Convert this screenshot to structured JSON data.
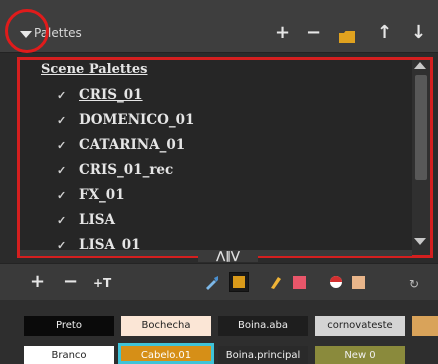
{
  "header": {
    "title": "Palettes",
    "add_glyph": "+",
    "remove_glyph": "−",
    "up_glyph": "↑",
    "down_glyph": "↓"
  },
  "palette_list": {
    "section_label": "Scene Palettes",
    "check_glyph": "✓",
    "items": [
      {
        "label": "CRIS_01"
      },
      {
        "label": "DOMENICO_01"
      },
      {
        "label": "CATARINA_01"
      },
      {
        "label": "CRIS_01_rec"
      },
      {
        "label": "FX_01"
      },
      {
        "label": "LISA"
      },
      {
        "label": "LISA_01"
      }
    ],
    "collapse_glyphs": "⋀‖⋁"
  },
  "colors_toolbar": {
    "add_glyph": "+",
    "remove_glyph": "−",
    "texture_glyph": "+T",
    "current_color": "#d99a1a",
    "pencil_color": "#e8566a",
    "tint_color": "#e8b58a",
    "refresh_glyph": "↻"
  },
  "swatches": [
    {
      "label": "Preto",
      "bg": "#0a0a0a",
      "fg": "#f0f0f0"
    },
    {
      "label": "Bochecha",
      "bg": "#fbe6d6",
      "fg": "#222222"
    },
    {
      "label": "Boina.aba",
      "bg": "#1e1e1e",
      "fg": "#f0f0f0"
    },
    {
      "label": "cornovateste",
      "bg": "#d4d4d4",
      "fg": "#222222"
    },
    {
      "label": "",
      "bg": "#d9a35a",
      "fg": "#222222"
    },
    {
      "label": "Branco",
      "bg": "#ffffff",
      "fg": "#222222"
    },
    {
      "label": "Cabelo.01",
      "bg": "#d68f17",
      "fg": "#ffffff"
    },
    {
      "label": "Boina.principal",
      "bg": "#2a2a2a",
      "fg": "#f0f0f0"
    },
    {
      "label": "New 0",
      "bg": "#8a8a3c",
      "fg": "#f0f0f0"
    }
  ]
}
